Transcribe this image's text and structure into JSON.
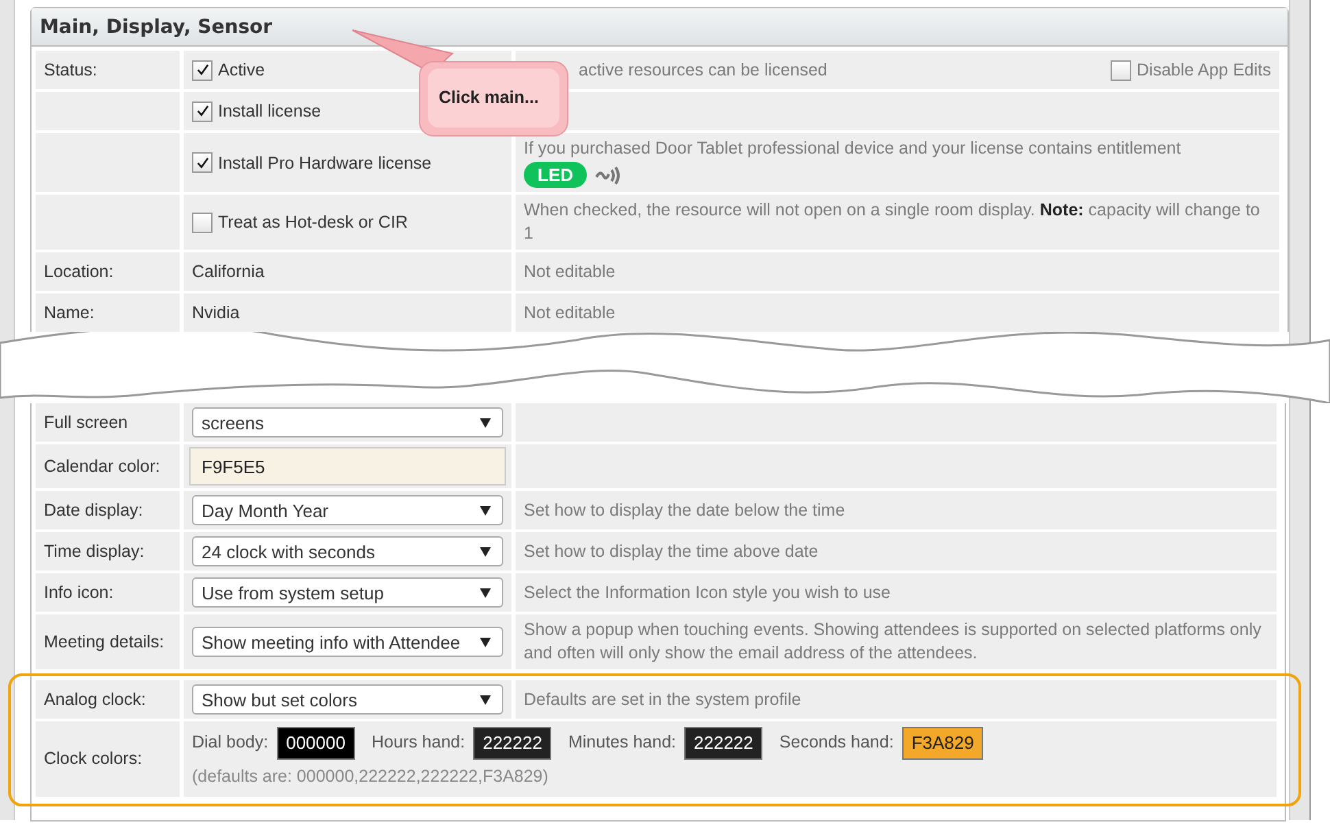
{
  "panel": {
    "title": "Main, Display, Sensor"
  },
  "callout": {
    "text": "Click main..."
  },
  "top_rows": [
    {
      "kind": "checkbox",
      "label": "Status:",
      "checkbox": {
        "label": "Active",
        "checked": true
      },
      "description": "active resources can be licensed",
      "side_checkbox": {
        "label": "Disable App Edits",
        "checked": false
      }
    },
    {
      "kind": "checkbox",
      "checkbox": {
        "label": "Install license",
        "checked": true
      }
    },
    {
      "kind": "checkbox",
      "checkbox": {
        "label": "Install Pro Hardware license",
        "checked": true
      },
      "description": "If you purchased Door Tablet professional device and your license contains entitlement",
      "badge": "LED"
    },
    {
      "kind": "checkbox",
      "checkbox": {
        "label": "Treat as Hot-desk or CIR",
        "checked": false
      },
      "description": "When checked, the resource will not open on a single room display.  **Note:** capacity will change to 1"
    },
    {
      "kind": "text",
      "label": "Location:",
      "value": "California",
      "description": "Not editable"
    },
    {
      "kind": "text",
      "label": "Name:",
      "value": "Nvidia",
      "description": "Not editable"
    }
  ],
  "bottom_rows": [
    {
      "kind": "select",
      "label": "Full screen",
      "value": "screens"
    },
    {
      "kind": "input",
      "label": "Calendar color:",
      "value": "F9F5E5"
    },
    {
      "kind": "select",
      "label": "Date display:",
      "value": "Day Month Year",
      "description": "Set how to display the date below the time"
    },
    {
      "kind": "select",
      "label": "Time display:",
      "value": "24 clock with seconds",
      "description": "Set how to display the time above date"
    },
    {
      "kind": "select",
      "label": "Info icon:",
      "value": "Use from system setup",
      "description": "Select the Information Icon style you wish to use"
    },
    {
      "kind": "select",
      "label": "Meeting details:",
      "value": "Show meeting info with Attendee",
      "description": "Show a popup when touching events.  Showing attendees is supported on selected platforms only and often will only show the email address of the attendees."
    }
  ],
  "highlighted_rows": [
    {
      "kind": "select",
      "label": "Analog clock:",
      "value": "Show but set colors",
      "description": "Defaults are set in the system profile"
    },
    {
      "kind": "colors",
      "label": "Clock colors:",
      "swatches": [
        {
          "label": "Dial body:",
          "value": "000000",
          "color": "#000000"
        },
        {
          "label": "Hours hand:",
          "value": "222222",
          "color": "#222222"
        },
        {
          "label": "Minutes hand:",
          "value": "222222",
          "color": "#222222"
        },
        {
          "label": "Seconds hand:",
          "value": "F3A829",
          "color": "#f3a829"
        }
      ],
      "note": "(defaults are: 000000,222222,222222,F3A829)"
    }
  ]
}
